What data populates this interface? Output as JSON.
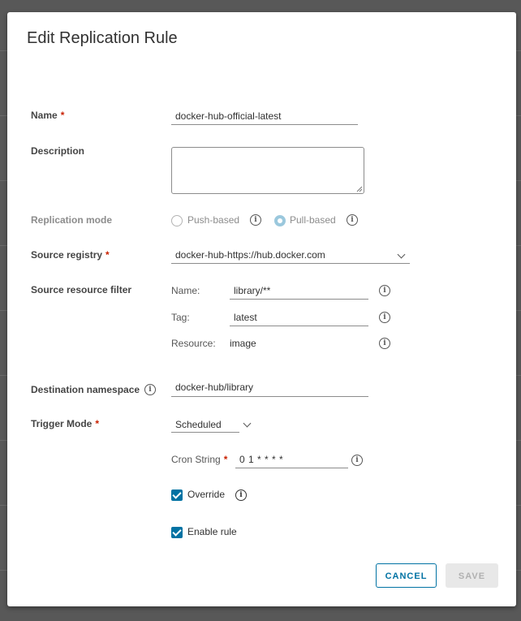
{
  "dialog": {
    "title": "Edit Replication Rule"
  },
  "name_field": {
    "label": "Name",
    "required_mark": "*",
    "value": "docker-hub-official-latest"
  },
  "description_field": {
    "label": "Description",
    "value": ""
  },
  "replication_mode": {
    "label": "Replication mode",
    "options": [
      {
        "label": "Push-based",
        "selected": false
      },
      {
        "label": "Pull-based",
        "selected": true
      }
    ]
  },
  "source_registry": {
    "label": "Source registry",
    "required_mark": "*",
    "value": "docker-hub-https://hub.docker.com"
  },
  "source_filter": {
    "label": "Source resource filter",
    "name_label": "Name:",
    "name_value": "library/**",
    "tag_label": "Tag:",
    "tag_value": "latest",
    "resource_label": "Resource:",
    "resource_value": "image"
  },
  "destination": {
    "label": "Destination namespace",
    "value": "docker-hub/library"
  },
  "trigger": {
    "label": "Trigger Mode",
    "required_mark": "*",
    "value": "Scheduled",
    "cron_label": "Cron String",
    "cron_required_mark": "*",
    "cron_value": "0 1 * * * *"
  },
  "options": {
    "override_label": "Override",
    "override_checked": true,
    "enable_label": "Enable rule",
    "enable_checked": true
  },
  "buttons": {
    "cancel": "CANCEL",
    "save": "SAVE"
  },
  "icons": {
    "info": "info-icon"
  },
  "colors": {
    "primary": "#0072a3",
    "required": "#c92100",
    "overlay": "#585858"
  }
}
